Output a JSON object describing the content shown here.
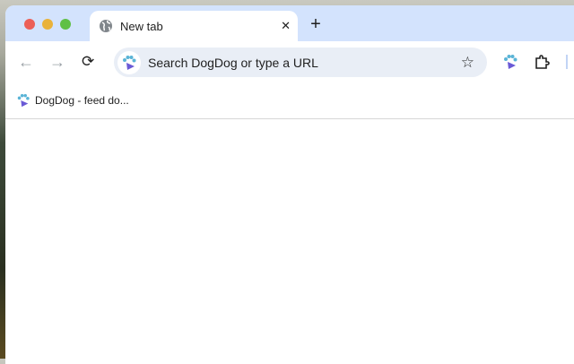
{
  "tab": {
    "title": "New tab",
    "close": "✕"
  },
  "new_tab": "+",
  "nav": {
    "back": "←",
    "forward": "→",
    "reload": "⟳"
  },
  "omnibox": {
    "placeholder": "Search DogDog or type a URL",
    "star": "☆"
  },
  "bookmarks": [
    {
      "label": "DogDog - feed do..."
    }
  ],
  "colors": {
    "tabstrip": "#d3e3fd",
    "omnibox": "#e9eef6",
    "paw_blue": "#5ab4d6",
    "paw_purple": "#6a5ad6"
  }
}
